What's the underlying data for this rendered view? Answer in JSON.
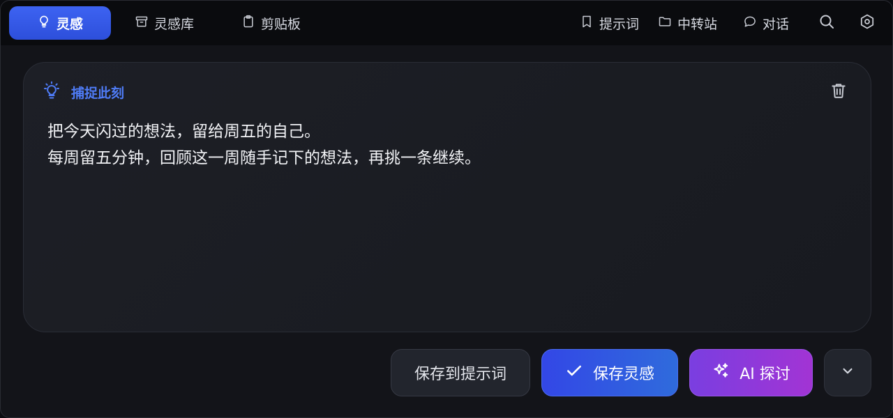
{
  "tabs": {
    "inspiration": "灵感",
    "library": "灵感库",
    "clipboard": "剪贴板"
  },
  "nav": {
    "prompts": "提示词",
    "transfer": "中转站",
    "chat": "对话"
  },
  "icons": {
    "active_tab": "lightbulb-icon",
    "library": "archive-icon",
    "clipboard": "clipboard-icon",
    "prompts": "bookmark-icon",
    "transfer": "folder-icon",
    "chat": "chat-bubble-icon",
    "search": "search-icon",
    "settings": "hexagon-settings-icon",
    "card": "lightbulb-icon",
    "delete": "trash-icon",
    "save": "check-icon",
    "ai": "sparkles-icon",
    "more": "chevron-down-icon"
  },
  "card": {
    "title": "捕捉此刻",
    "lines": [
      "把今天闪过的想法，留给周五的自己。",
      "每周留五分钟，回顾这一周随手记下的想法，再挑一条继续。"
    ]
  },
  "actions": {
    "save_to_prompt": "保存到提示词",
    "save_inspiration": "保存灵感",
    "ai_explore": "AI 探讨"
  },
  "colors": {
    "accent": "#3d63f2",
    "card_title": "#4f7cf7",
    "ai_gradient_start": "#7a3ee0",
    "ai_gradient_end": "#a234d4"
  }
}
